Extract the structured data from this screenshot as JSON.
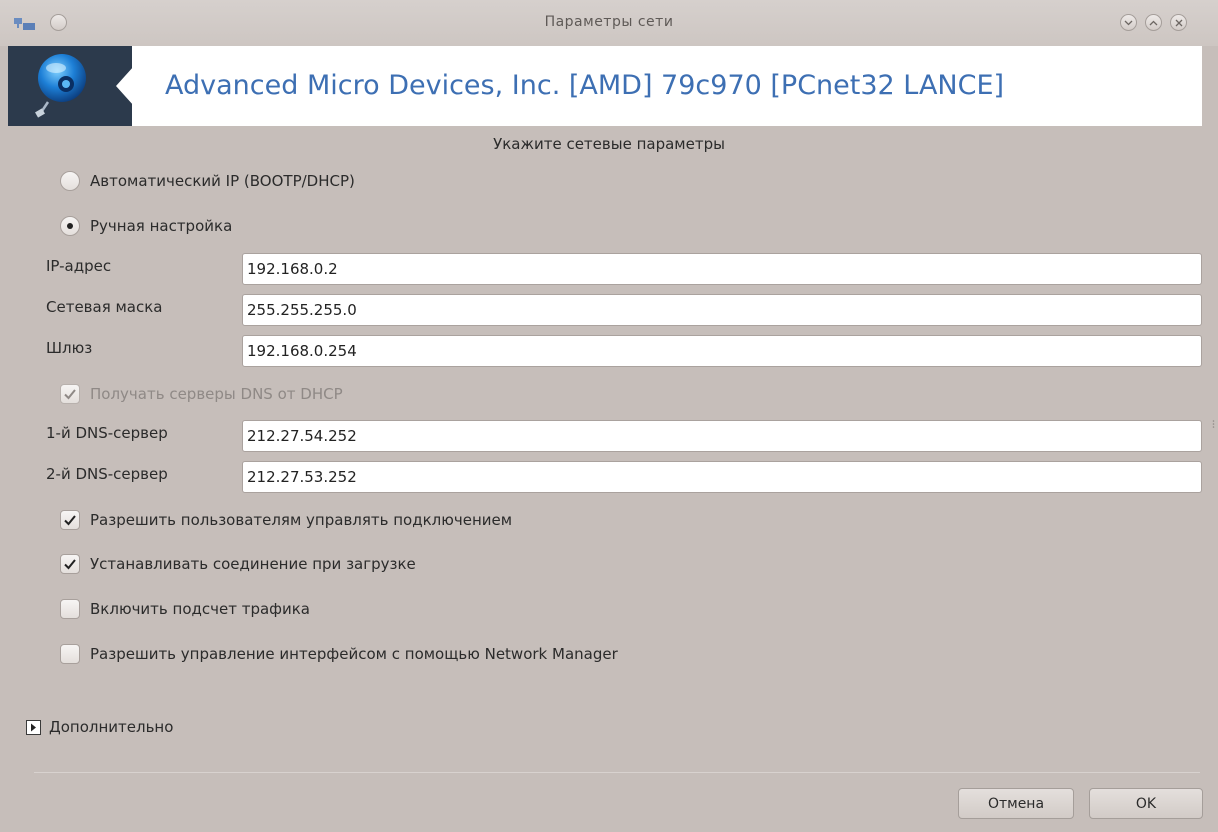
{
  "window": {
    "title": "Параметры сети"
  },
  "banner": {
    "title": "Advanced Micro Devices, Inc. [AMD] 79c970 [PCnet32 LANCE]",
    "icon": "network-globe-icon"
  },
  "form": {
    "subtitle": "Укажите сетевые параметры",
    "radio_auto": {
      "label": "Автоматический IP (BOOTP/DHCP)",
      "selected": false
    },
    "radio_manual": {
      "label": "Ручная настройка",
      "selected": true
    },
    "ip": {
      "label": "IP-адрес",
      "value": "192.168.0.2"
    },
    "netmask": {
      "label": "Сетевая маска",
      "value": "255.255.255.0"
    },
    "gateway": {
      "label": "Шлюз",
      "value": "192.168.0.254"
    },
    "dns_from_dhcp": {
      "label": "Получать серверы DNS от DHCP",
      "checked": true,
      "disabled": true
    },
    "dns1": {
      "label": "1-й DNS-сервер",
      "value": "212.27.54.252"
    },
    "dns2": {
      "label": "2-й DNS-сервер",
      "value": "212.27.53.252"
    },
    "allow_users": {
      "label": "Разрешить пользователям управлять подключением",
      "checked": true
    },
    "start_at_boot": {
      "label": "Устанавливать соединение при загрузке",
      "checked": true
    },
    "traffic_accounting": {
      "label": "Включить подсчет трафика",
      "checked": false
    },
    "network_manager": {
      "label": "Разрешить управление интерфейсом с помощью Network Manager",
      "checked": false
    },
    "advanced": {
      "label": "Дополнительно"
    }
  },
  "buttons": {
    "cancel": "Отмена",
    "ok": "OK"
  },
  "colors": {
    "accent_title": "#3d6fb3",
    "background": "#c6beba",
    "banner_icon_bg": "#2c3a4c"
  }
}
